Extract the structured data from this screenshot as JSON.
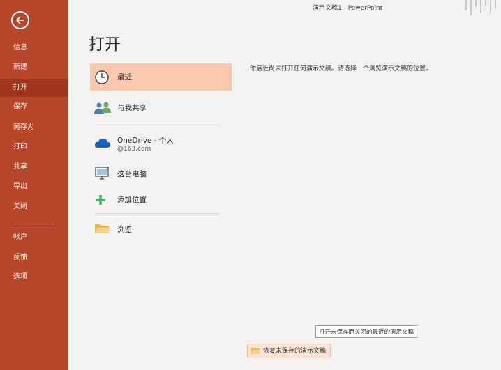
{
  "window": {
    "title": "演示文稿1  -  PowerPoint"
  },
  "nav": {
    "back_icon": "back-arrow-icon",
    "items": [
      {
        "label": "信息",
        "active": false
      },
      {
        "label": "新建",
        "active": false
      },
      {
        "label": "打开",
        "active": true
      },
      {
        "label": "保存",
        "active": false
      },
      {
        "label": "另存为",
        "active": false
      },
      {
        "label": "打印",
        "active": false
      },
      {
        "label": "共享",
        "active": false
      },
      {
        "label": "导出",
        "active": false
      },
      {
        "label": "关闭",
        "active": false
      },
      {
        "label": "帐户",
        "active": false
      },
      {
        "label": "反馈",
        "active": false
      },
      {
        "label": "选项",
        "active": false
      }
    ]
  },
  "page": {
    "title": "打开"
  },
  "locations": [
    {
      "label": "最近",
      "icon": "clock-icon",
      "active": true
    },
    {
      "label": "与我共享",
      "icon": "people-icon",
      "active": false
    },
    {
      "label": "OneDrive - 个人",
      "sub": "@163.com",
      "icon": "cloud-icon",
      "active": false
    },
    {
      "label": "这台电脑",
      "icon": "computer-icon",
      "active": false
    },
    {
      "label": "添加位置",
      "icon": "plus-icon",
      "active": false
    },
    {
      "label": "浏览",
      "icon": "folder-icon",
      "active": false
    }
  ],
  "main": {
    "message": "你最近尚未打开任何演示文稿。请选择一个浏览演示文稿的位置。",
    "tooltip": "打开未保存而关闭的最近的演示文稿",
    "recover_button": "恢复未保存的演示文稿"
  },
  "colors": {
    "nav_bg": "#b7472a",
    "nav_active": "#a1341c",
    "location_active": "#fcc8ad",
    "page_bg": "#f3f2f1"
  }
}
